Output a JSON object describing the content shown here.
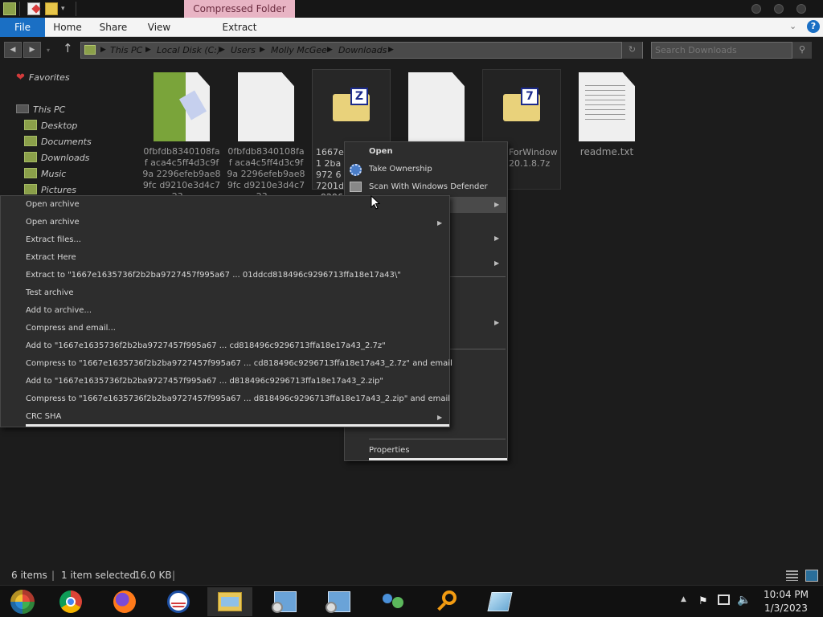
{
  "titlebar": {
    "context_tab": "Compressed Folder Tools"
  },
  "ribbon": {
    "tabs": [
      {
        "label": "File"
      },
      {
        "label": "Home"
      },
      {
        "label": "Share"
      },
      {
        "label": "View"
      },
      {
        "label": "Extract"
      }
    ]
  },
  "address": {
    "crumbs": [
      "This PC",
      "Local Disk (C:)",
      "Users",
      "Molly McGee",
      "Downloads"
    ],
    "search_placeholder": "Search Downloads"
  },
  "nav": {
    "favorites": "Favorites",
    "this_pc": "This PC",
    "items": [
      "Desktop",
      "Documents",
      "Downloads",
      "Music",
      "Pictures"
    ]
  },
  "files": [
    {
      "name": "0fbfdb8340108faf aca4c5ff4d3c9f9a 2296efeb9ae89fc d9210e3d4c723...",
      "icon": "zip-folder-icon"
    },
    {
      "name": "0fbfdb8340108faf aca4c5ff4d3c9f9a 2296efeb9ae89fc d9210e3d4c723...",
      "icon": "document-icon"
    },
    {
      "name": "1667e1 2ba972 67201d c92967",
      "icon": "7zip-z-archive-icon",
      "selected": true
    },
    {
      "name": "",
      "icon": "document-icon"
    },
    {
      "name": "ForWindow 20.1.8.7z",
      "icon": "7zip-archive-icon"
    },
    {
      "name": "readme.txt",
      "icon": "text-file-icon"
    }
  ],
  "context_menu": {
    "items": [
      "Open",
      "Take Ownership",
      "Scan With Windows Defender",
      "Properties"
    ]
  },
  "submenu": {
    "items": [
      "Open archive",
      "Open archive",
      "Extract files...",
      "Extract Here",
      "Extract to \"1667e1635736f2b2ba9727457f995a67 ... 01ddcd818496c9296713ffa18e17a43\\\"",
      "Test archive",
      "Add to archive...",
      "Compress and email...",
      "Add to \"1667e1635736f2b2ba9727457f995a67 ... cd818496c9296713ffa18e17a43_2.7z\"",
      "Compress to \"1667e1635736f2b2ba9727457f995a67 ... cd818496c9296713ffa18e17a43_2.7z\" and email",
      "Add to \"1667e1635736f2b2ba9727457f995a67 ... d818496c9296713ffa18e17a43_2.zip\"",
      "Compress to \"1667e1635736f2b2ba9727457f995a67 ... d818496c9296713ffa18e17a43_2.zip\" and email",
      "CRC SHA"
    ]
  },
  "status": {
    "count": "6 items",
    "selected": "1 item selected",
    "size": "16.0 KB"
  },
  "taskbar": {
    "time": "10:04 PM",
    "date": "1/3/2023"
  },
  "colors": {
    "accent": "#1a6fc4",
    "context_tab": "#e8b4c4",
    "background": "#1c1c1c"
  }
}
